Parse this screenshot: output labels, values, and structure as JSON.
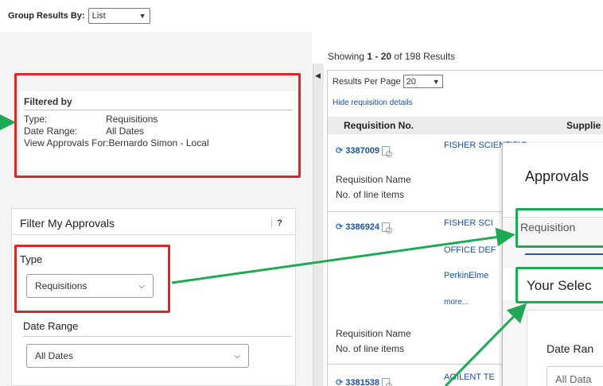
{
  "group": {
    "label": "Group Results By:",
    "value": "List"
  },
  "filtered_by": {
    "title": "Filtered by",
    "rows": [
      {
        "key": "Type:",
        "value": "Requisitions"
      },
      {
        "key": "Date Range:",
        "value": "All Dates"
      },
      {
        "key": "View Approvals For:",
        "value": "Bernardo Simon - Local"
      }
    ]
  },
  "filter_panel": {
    "title": "Filter My Approvals",
    "help": "?",
    "type_label": "Type",
    "type_value": "Requisitions",
    "date_label": "Date Range",
    "date_value": "All Dates"
  },
  "results": {
    "showing_prefix": "Showing ",
    "showing_range": "1 - 20",
    "showing_of": " of 198 Results",
    "per_page_label": "Results Per Page",
    "per_page_value": "20",
    "hide_details": "Hide requisition details",
    "col_requisition": "Requisition No.",
    "col_supplier": "Supplie",
    "rows": [
      {
        "number": "3387009",
        "suppliers": [
          "FISHER SCIENTIFIC"
        ],
        "name_label": "Requisition Name",
        "items_label": "No. of line items"
      },
      {
        "number": "3386924",
        "suppliers": [
          "FISHER SCI",
          "OFFICE DEF",
          "PerkinElme",
          "more..."
        ],
        "name_label": "Requisition Name",
        "items_label": "No. of line items"
      },
      {
        "number": "3381538",
        "suppliers": [
          "AGILENT TE"
        ]
      }
    ]
  },
  "modal": {
    "title": "Approvals",
    "tab": "Requisition",
    "section": "Your Selec",
    "date_label": "Date Ran",
    "date_value": "All Data"
  },
  "colors": {
    "annotation_red": "#d62a2a",
    "annotation_green": "#1ea955",
    "link": "#1a4f9c"
  }
}
